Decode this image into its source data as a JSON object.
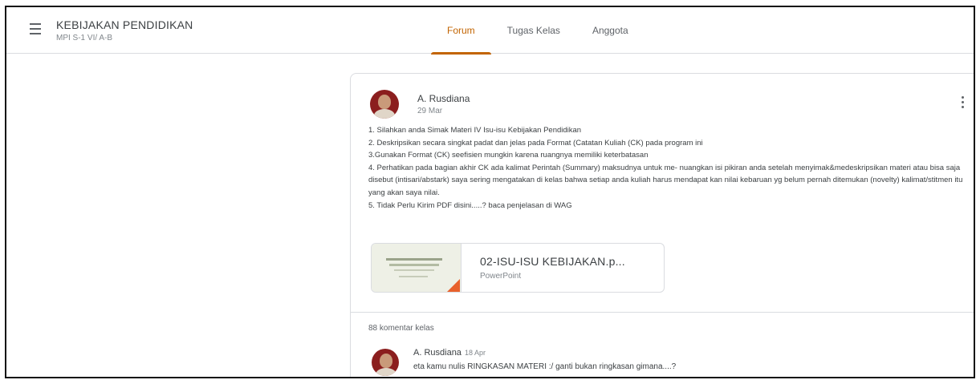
{
  "header": {
    "title": "KEBIJAKAN PENDIDIKAN",
    "subtitle": "MPI S-1 VI/ A-B",
    "tabs": [
      {
        "label": "Forum",
        "active": true
      },
      {
        "label": "Tugas Kelas",
        "active": false
      },
      {
        "label": "Anggota",
        "active": false
      }
    ]
  },
  "post": {
    "author": "A. Rusdiana",
    "date": "29 Mar",
    "lines": [
      "1. Silahkan anda Simak Materi IV Isu-isu Kebijakan Pendidikan",
      "2. Deskripsikan secara singkat padat dan jelas pada Format (Catatan Kuliah (CK) pada program ini",
      "3.Gunakan Format (CK) seefisien mungkin karena ruangnya memiliki keterbatasan",
      "4. Perhatikan pada bagian akhir CK ada kalimat Perintah (Summary) maksudnya untuk me- nuangkan isi pikiran anda setelah menyimak&medeskripsikan materi atau bisa saja disebut (intisari/abstark) saya sering mengatakan di kelas bahwa setiap anda kuliah harus mendapat kan nilai kebaruan yg belum pernah ditemukan (novelty) kalimat/stitmen itu yang akan saya nilai.",
      "5. Tidak Perlu Kirim PDF disini.....? baca penjelasan di WAG"
    ],
    "attachment": {
      "name": "02-ISU-ISU KEBIJAKAN.p...",
      "type": "PowerPoint"
    },
    "comments_count": "88 komentar kelas",
    "comment": {
      "author": "A. Rusdiana",
      "date": "18 Apr",
      "text": "eta kamu nulis RINGKASAN MATERI :/ ganti bukan ringkasan gimana....?"
    }
  },
  "colors": {
    "accent": "#c26401",
    "border": "#dadce0",
    "powerpoint": "#e8612c"
  }
}
